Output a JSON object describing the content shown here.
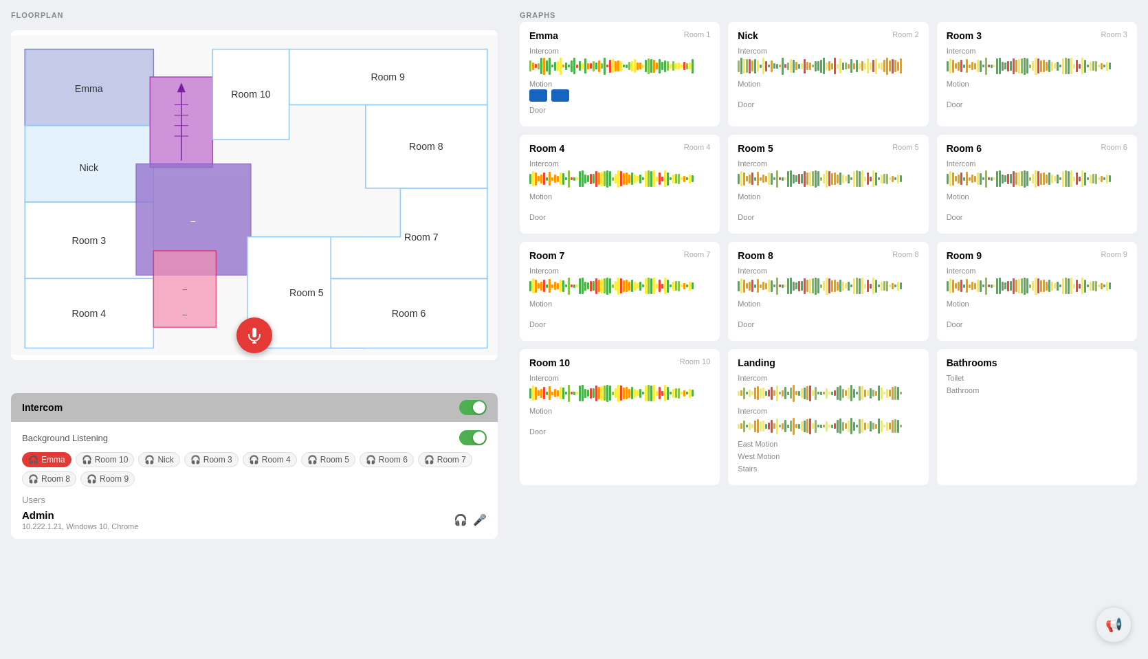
{
  "floorplan": {
    "title": "FLOORPLAN"
  },
  "graphs": {
    "title": "GRAPHS",
    "cards": [
      {
        "id": "emma",
        "name": "Emma",
        "room": "Room 1",
        "hasMotionBlocks": true,
        "hasDoor": true,
        "intercomLabel": "Intercom",
        "motionLabel": "Motion",
        "doorLabel": "Door"
      },
      {
        "id": "nick",
        "name": "Nick",
        "room": "Room 2",
        "hasMotionBlocks": false,
        "hasDoor": true,
        "intercomLabel": "Intercom",
        "motionLabel": "Motion",
        "doorLabel": "Door"
      },
      {
        "id": "room3",
        "name": "Room 3",
        "room": "Room 3",
        "hasMotionBlocks": false,
        "hasDoor": true,
        "intercomLabel": "Intercom",
        "motionLabel": "Motion",
        "doorLabel": "Door"
      },
      {
        "id": "room4",
        "name": "Room 4",
        "room": "Room 4",
        "hasMotionBlocks": false,
        "hasDoor": true,
        "intercomLabel": "Intercom",
        "motionLabel": "Motion",
        "doorLabel": "Door"
      },
      {
        "id": "room5",
        "name": "Room 5",
        "room": "Room 5",
        "hasMotionBlocks": false,
        "hasDoor": true,
        "intercomLabel": "Intercom",
        "motionLabel": "Motion",
        "doorLabel": "Door"
      },
      {
        "id": "room6",
        "name": "Room 6",
        "room": "Room 6",
        "hasMotionBlocks": false,
        "hasDoor": true,
        "intercomLabel": "Intercom",
        "motionLabel": "Motion",
        "doorLabel": "Door"
      },
      {
        "id": "room7",
        "name": "Room 7",
        "room": "Room 7",
        "hasMotionBlocks": false,
        "hasDoor": true,
        "intercomLabel": "Intercom",
        "motionLabel": "Motion",
        "doorLabel": "Door"
      },
      {
        "id": "room8",
        "name": "Room 8",
        "room": "Room 8",
        "hasMotionBlocks": false,
        "hasDoor": true,
        "intercomLabel": "Intercom",
        "motionLabel": "Motion",
        "doorLabel": "Door"
      },
      {
        "id": "room9",
        "name": "Room 9",
        "room": "Room 9",
        "hasMotionBlocks": false,
        "hasDoor": true,
        "intercomLabel": "Intercom",
        "motionLabel": "Motion",
        "doorLabel": "Door"
      },
      {
        "id": "room10",
        "name": "Room 10",
        "room": "Room 10",
        "hasMotionBlocks": false,
        "hasDoor": true,
        "intercomLabel": "Intercom",
        "motionLabel": "Motion",
        "doorLabel": "Door"
      },
      {
        "id": "landing",
        "name": "Landing",
        "room": "",
        "hasMotionBlocks": false,
        "hasDoor": false,
        "intercomLabel": "Intercom",
        "motionLabel": "East Motion",
        "extraLabel1": "West Motion",
        "extraLabel2": "Stairs"
      },
      {
        "id": "bathrooms",
        "name": "Bathrooms",
        "room": "",
        "hasMotionBlocks": false,
        "hasDoor": false,
        "intercomLabel": "",
        "motionLabel": "Toilet",
        "extraLabel1": "Bathroom",
        "noIntercom": true
      }
    ]
  },
  "intercom": {
    "title": "Intercom",
    "bgListeningLabel": "Background Listening",
    "toggleOn": true,
    "bgToggleOn": true,
    "rooms": [
      {
        "id": "emma",
        "label": "Emma",
        "active": true
      },
      {
        "id": "room10",
        "label": "Room 10",
        "active": false
      },
      {
        "id": "nick",
        "label": "Nick",
        "active": false
      },
      {
        "id": "room3",
        "label": "Room 3",
        "active": false
      },
      {
        "id": "room4",
        "label": "Room 4",
        "active": false
      },
      {
        "id": "room5",
        "label": "Room 5",
        "active": false
      },
      {
        "id": "room6",
        "label": "Room 6",
        "active": false
      },
      {
        "id": "room7",
        "label": "Room 7",
        "active": false
      },
      {
        "id": "room8",
        "label": "Room 8",
        "active": false
      },
      {
        "id": "room9",
        "label": "Room 9",
        "active": false
      }
    ]
  },
  "users": {
    "label": "Users",
    "admin": {
      "name": "Admin",
      "meta": "10.222.1.21, Windows 10, Chrome"
    }
  }
}
